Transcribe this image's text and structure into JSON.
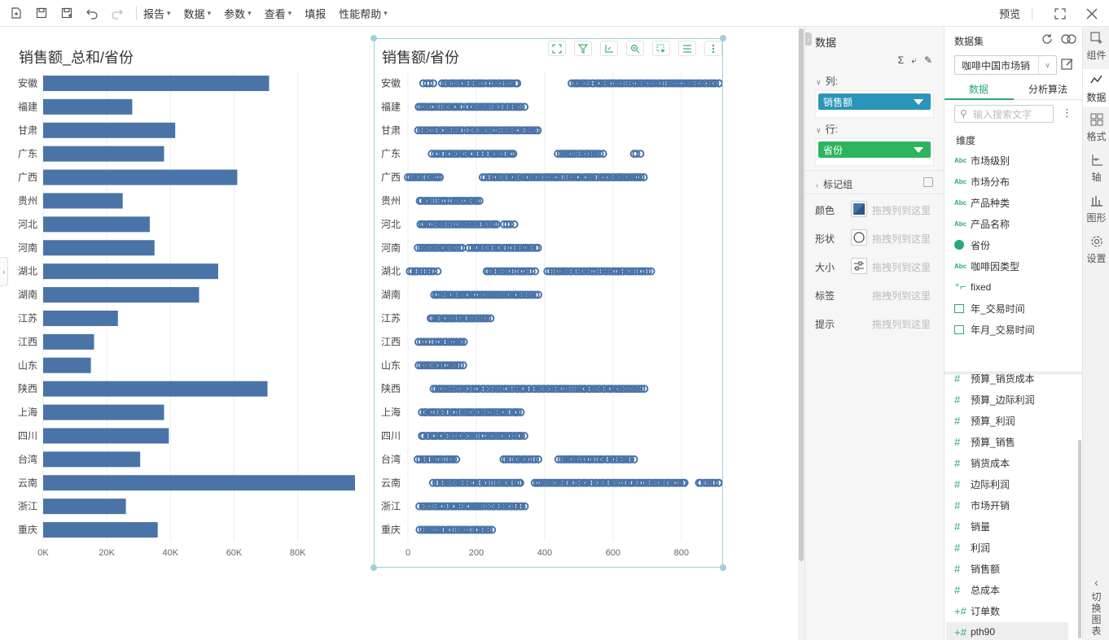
{
  "toolbar": {
    "menus": [
      "报告",
      "数据",
      "参数",
      "查看",
      "填报",
      "性能帮助"
    ],
    "preview": "预览"
  },
  "chart1": {
    "title": "销售额_总和/省份",
    "chart_data": {
      "type": "bar",
      "orientation": "horizontal",
      "categories": [
        "安徽",
        "福建",
        "甘肃",
        "广东",
        "广西",
        "贵州",
        "河北",
        "河南",
        "湖北",
        "湖南",
        "江苏",
        "江西",
        "山东",
        "陕西",
        "上海",
        "四川",
        "台湾",
        "云南",
        "浙江",
        "重庆"
      ],
      "values": [
        71000,
        28000,
        41500,
        38000,
        61000,
        25000,
        33500,
        35000,
        55000,
        49000,
        23500,
        16000,
        15000,
        70500,
        38000,
        39500,
        30500,
        98000,
        26000,
        36000
      ],
      "xticks": [
        "0K",
        "20K",
        "40K",
        "60K",
        "80K"
      ],
      "xlim": [
        0,
        98000
      ],
      "color": "#4a74a8",
      "grid": true
    }
  },
  "chart2": {
    "title": "销售额/省份",
    "chart_data": {
      "type": "scatter",
      "categories": [
        "安徽",
        "福建",
        "甘肃",
        "广东",
        "广西",
        "贵州",
        "河北",
        "河南",
        "湖北",
        "湖南",
        "江苏",
        "江西",
        "山东",
        "陕西",
        "上海",
        "四川",
        "台湾",
        "云南",
        "浙江",
        "重庆"
      ],
      "xticks": [
        "0",
        "200",
        "400",
        "600",
        "800"
      ],
      "xlim": [
        0,
        910
      ],
      "color": "#4a74a8",
      "grid": true,
      "series_ranges": [
        [
          [
            45,
            75
          ],
          [
            100,
            320
          ],
          [
            480,
            915
          ]
        ],
        [
          [
            30,
            160
          ],
          [
            170,
            340
          ]
        ],
        [
          [
            30,
            160
          ],
          [
            170,
            380
          ]
        ],
        [
          [
            70,
            310
          ],
          [
            440,
            570
          ],
          [
            660,
            680
          ]
        ],
        [
          [
            0,
            95
          ],
          [
            220,
            690
          ]
        ],
        [
          [
            35,
            210
          ]
        ],
        [
          [
            35,
            260
          ],
          [
            280,
            310
          ]
        ],
        [
          [
            30,
            160
          ],
          [
            180,
            380
          ]
        ],
        [
          [
            5,
            85
          ],
          [
            230,
            370
          ],
          [
            410,
            710
          ]
        ],
        [
          [
            75,
            380
          ]
        ],
        [
          [
            65,
            240
          ]
        ],
        [
          [
            30,
            165
          ]
        ],
        [
          [
            30,
            160
          ]
        ],
        [
          [
            75,
            690
          ]
        ],
        [
          [
            40,
            330
          ]
        ],
        [
          [
            40,
            340
          ]
        ],
        [
          [
            30,
            140
          ],
          [
            280,
            380
          ],
          [
            440,
            660
          ]
        ],
        [
          [
            75,
            330
          ],
          [
            370,
            810
          ],
          [
            850,
            915
          ]
        ],
        [
          [
            35,
            340
          ]
        ],
        [
          [
            35,
            245
          ]
        ]
      ]
    }
  },
  "config": {
    "title": "数据",
    "tools": [
      "Σ",
      "⤶",
      "✎"
    ],
    "col_label": "列:",
    "col_pill": "销售额",
    "row_label": "行:",
    "row_pill": "省份",
    "marks_label": "标记组",
    "props": [
      {
        "label": "颜色",
        "hint": "拖拽列到这里"
      },
      {
        "label": "形状",
        "hint": "拖拽列到这里"
      },
      {
        "label": "大小",
        "hint": "拖拽列到这里"
      },
      {
        "label": "标签",
        "hint": "拖拽列到这里"
      },
      {
        "label": "提示",
        "hint": "拖拽列到这里"
      }
    ],
    "colors": {
      "col_pill": "#2b95b9",
      "row_pill": "#2db55d",
      "swatch": "#4a74a8"
    }
  },
  "dataset": {
    "title": "数据集",
    "selected": "咖啡中国市场销",
    "tabs": [
      "数据",
      "分析算法"
    ],
    "search_placeholder": "输入搜索文字",
    "dim_title": "维度",
    "dimensions": [
      {
        "type": "Abc",
        "name": "市场级别"
      },
      {
        "type": "Abc",
        "name": "市场分布"
      },
      {
        "type": "Abc",
        "name": "产品种类"
      },
      {
        "type": "Abc",
        "name": "产品名称"
      },
      {
        "type": "geo",
        "name": "省份"
      },
      {
        "type": "Abc",
        "name": "咖啡因类型"
      },
      {
        "type": "calc",
        "name": "fixed"
      },
      {
        "type": "date",
        "name": "年_交易时间"
      },
      {
        "type": "date",
        "name": "年月_交易时间"
      }
    ],
    "measures": [
      {
        "type": "#",
        "name": "预算_销货成本"
      },
      {
        "type": "#",
        "name": "预算_边际利润"
      },
      {
        "type": "#",
        "name": "预算_利润"
      },
      {
        "type": "#",
        "name": "预算_销售"
      },
      {
        "type": "#",
        "name": "销货成本"
      },
      {
        "type": "#",
        "name": "边际利润"
      },
      {
        "type": "#",
        "name": "市场开销"
      },
      {
        "type": "#",
        "name": "销量"
      },
      {
        "type": "#",
        "name": "利润"
      },
      {
        "type": "#",
        "name": "销售额"
      },
      {
        "type": "#",
        "name": "总成本"
      },
      {
        "type": "+#",
        "name": "订单数"
      },
      {
        "type": "+#",
        "name": "pth90"
      }
    ]
  },
  "rail": {
    "items": [
      {
        "icon": "components-icon",
        "label": "组件"
      },
      {
        "icon": "data-icon",
        "label": "数据"
      },
      {
        "icon": "format-icon",
        "label": "格式"
      },
      {
        "icon": "axis-icon",
        "label": "轴"
      },
      {
        "icon": "shape-icon",
        "label": "图形"
      },
      {
        "icon": "settings-icon",
        "label": "设置"
      }
    ],
    "switch_label": "切换图表"
  }
}
